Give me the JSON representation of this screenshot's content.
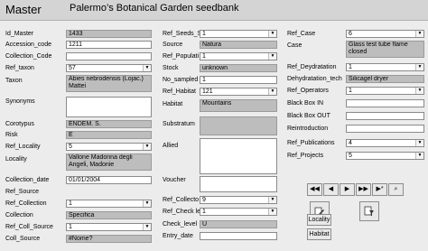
{
  "header": {
    "form_label": "Master",
    "title": "Palermo’s Botanical Garden seedbank"
  },
  "col1": {
    "id_master": {
      "label": "Id_Master",
      "value": "1433"
    },
    "accession_code": {
      "label": "Accession_code",
      "value": "1211"
    },
    "collection_code": {
      "label": "Collection_Code",
      "value": ""
    },
    "ref_taxon": {
      "label": "Ref_taxon",
      "value": "57"
    },
    "taxon": {
      "label": "Taxon",
      "value": "Abies nebrodensis (Lojac.) Mattei"
    },
    "synonyms": {
      "label": "Synonyms",
      "value": ""
    },
    "corotypus": {
      "label": "Corotypus",
      "value": "ENDEM. S."
    },
    "risk": {
      "label": "Risk",
      "value": "E"
    },
    "ref_locality": {
      "label": "Ref_Locality",
      "value": "5"
    },
    "locality": {
      "label": "Locality",
      "value": "Vallone Madonna degli Angeli, Madonie"
    },
    "collection_date": {
      "label": "Collection_date",
      "value": "01/01/2004"
    },
    "ref_source": {
      "label": "Ref_Source",
      "value": ""
    },
    "ref_collection": {
      "label": "Ref_Collection",
      "value": "1"
    },
    "collection": {
      "label": "Collection",
      "value": "Specifica"
    },
    "ref_coll_source": {
      "label": "Ref_Coll_Source",
      "value": "1"
    },
    "coll_source": {
      "label": "Coll_Source",
      "value": "#Nome?"
    }
  },
  "col2": {
    "ref_seeds_s": {
      "label": "Ref_Seeds_S",
      "value": "1"
    },
    "source": {
      "label": "Source",
      "value": "Natura"
    },
    "ref_populati": {
      "label": "Ref_Populati",
      "value": "1"
    },
    "stock": {
      "label": "Stock",
      "value": "unknown"
    },
    "no_sampled": {
      "label": "No_sampled",
      "value": "1"
    },
    "ref_habitat": {
      "label": "Ref_Habitat",
      "value": "121"
    },
    "habitat": {
      "label": "Habitat",
      "value": "Mountains"
    },
    "substratum": {
      "label": "Substratum",
      "value": ""
    },
    "allied": {
      "label": "Allied",
      "value": ""
    },
    "voucher": {
      "label": "Voucher",
      "value": ""
    },
    "ref_collecto": {
      "label": "Ref_Collecto",
      "value": "9"
    },
    "ref_check_le": {
      "label": "Ref_Check le",
      "value": "1"
    },
    "check_level": {
      "label": "Check_level",
      "value": "U"
    },
    "entry_date": {
      "label": "Entry_date",
      "value": ""
    }
  },
  "col3": {
    "ref_case": {
      "label": "Ref_Case",
      "value": "6"
    },
    "case": {
      "label": "Case",
      "value": "Glass test tube flame closed"
    },
    "ref_deydratation": {
      "label": "Ref_Deydratation",
      "value": "1"
    },
    "dehydratation_tech": {
      "label": "Dehydratation_tech",
      "value": "Silicagel dryer"
    },
    "ref_operators": {
      "label": "Ref_Operators",
      "value": "1"
    },
    "black_box_in": {
      "label": "Black Box IN",
      "value": ""
    },
    "black_box_out": {
      "label": "Black Box OUT",
      "value": ""
    },
    "reintroduction": {
      "label": "Reintroduction",
      "value": ""
    },
    "ref_publications": {
      "label": "Ref_Publications",
      "value": "4"
    },
    "ref_projects": {
      "label": "Ref_Projects",
      "value": "5"
    }
  },
  "nav": {
    "first": "◀◀",
    "prev": "◀",
    "next": "▶",
    "last": "▶▶",
    "new": "▶*",
    "find": "⌕"
  },
  "buttons": {
    "locality": "Locality",
    "habitat": "Habitat"
  },
  "icons": {
    "combo_arrow": "chevron-down-icon",
    "first": "first-record-icon",
    "prev": "previous-record-icon",
    "next": "next-record-icon",
    "last": "last-record-icon",
    "new": "new-record-icon",
    "find": "binoculars-icon",
    "action1": "edit-icon",
    "action2": "filter-icon"
  }
}
